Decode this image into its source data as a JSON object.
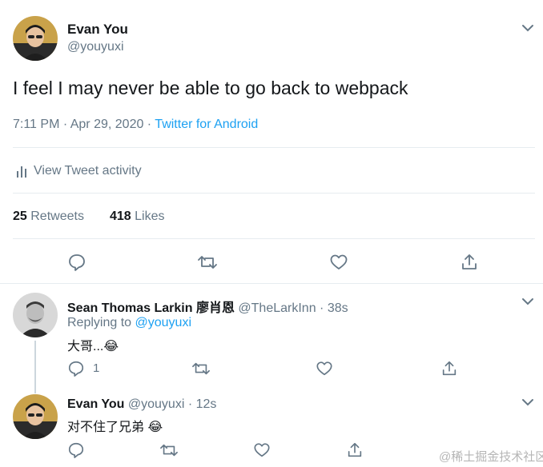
{
  "tweet": {
    "author_name": "Evan You",
    "author_handle": "@youyuxi",
    "text": "I feel I may never be able to go back to webpack",
    "time": "7:11 PM · Apr 29, 2020 · ",
    "source": "Twitter for Android",
    "activity_label": "View Tweet activity",
    "retweets_count": "25",
    "retweets_label": "Retweets",
    "likes_count": "418",
    "likes_label": "Likes"
  },
  "replies": [
    {
      "author_name": "Sean Thomas Larkin 廖肖恩",
      "author_handle": "@TheLarkInn",
      "time": "· 38s",
      "replying_prefix": "Replying to ",
      "replying_handle": "@youyuxi",
      "text": "大哥...",
      "emoji": "😂",
      "reply_count": "1"
    },
    {
      "author_name": "Evan You",
      "author_handle": "@youyuxi",
      "time": "· 12s",
      "text": "对不住了兄弟",
      "emoji": "😂"
    }
  ],
  "watermark": "@稀土掘金技术社区",
  "icons": [
    "chevron-down-icon",
    "reply-icon",
    "retweet-icon",
    "like-icon",
    "share-icon",
    "activity-icon"
  ],
  "colors": {
    "accent": "#1da1f2",
    "muted": "#657786",
    "divider": "#e6ecf0",
    "text": "#14171a"
  }
}
